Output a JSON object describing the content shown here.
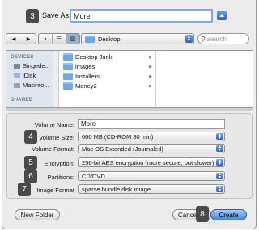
{
  "save_as": {
    "step": "3",
    "label": "Save As:",
    "value": "More",
    "expand_icon": "chevron-up-icon"
  },
  "toolbar": {
    "location": "Desktop",
    "search_placeholder": "search"
  },
  "sidebar": {
    "devices_header": "DEVICES",
    "devices": [
      "Singede...",
      "iDisk",
      "Macinto..."
    ],
    "shared_header": "SHARED"
  },
  "browser": {
    "items": [
      {
        "name": "Desktop Junk",
        "icon": "folder-icon"
      },
      {
        "name": "images",
        "icon": "folder-icon"
      },
      {
        "name": "Installers",
        "icon": "folder-icon"
      },
      {
        "name": "Money2",
        "icon": "folder-icon"
      }
    ]
  },
  "form": {
    "volume_name_label": "Volume Name:",
    "volume_name_value": "More",
    "volume_size_step": "4",
    "volume_size_label": "Volume Size:",
    "volume_size_value": "660 MB (CD-ROM 80 min)",
    "volume_format_label": "Volume Format:",
    "volume_format_value": "Mac OS Extended (Journaled)",
    "encryption_step": "5",
    "encryption_label": "Encryption:",
    "encryption_value": "256-bit AES encryption (more secure, but slower)",
    "partitions_step": "6",
    "partitions_label": "Partitions:",
    "partitions_value": "CD/DVD",
    "image_format_step": "7",
    "image_format_label": "Image Format",
    "image_format_value": "sparse bundle disk image"
  },
  "buttons": {
    "new_folder": "New Folder",
    "cancel": "Cancel",
    "create": "Create",
    "create_step": "8"
  },
  "colors": {
    "accent": "#2f6fd6",
    "step_badge": "#4a4a4a"
  }
}
